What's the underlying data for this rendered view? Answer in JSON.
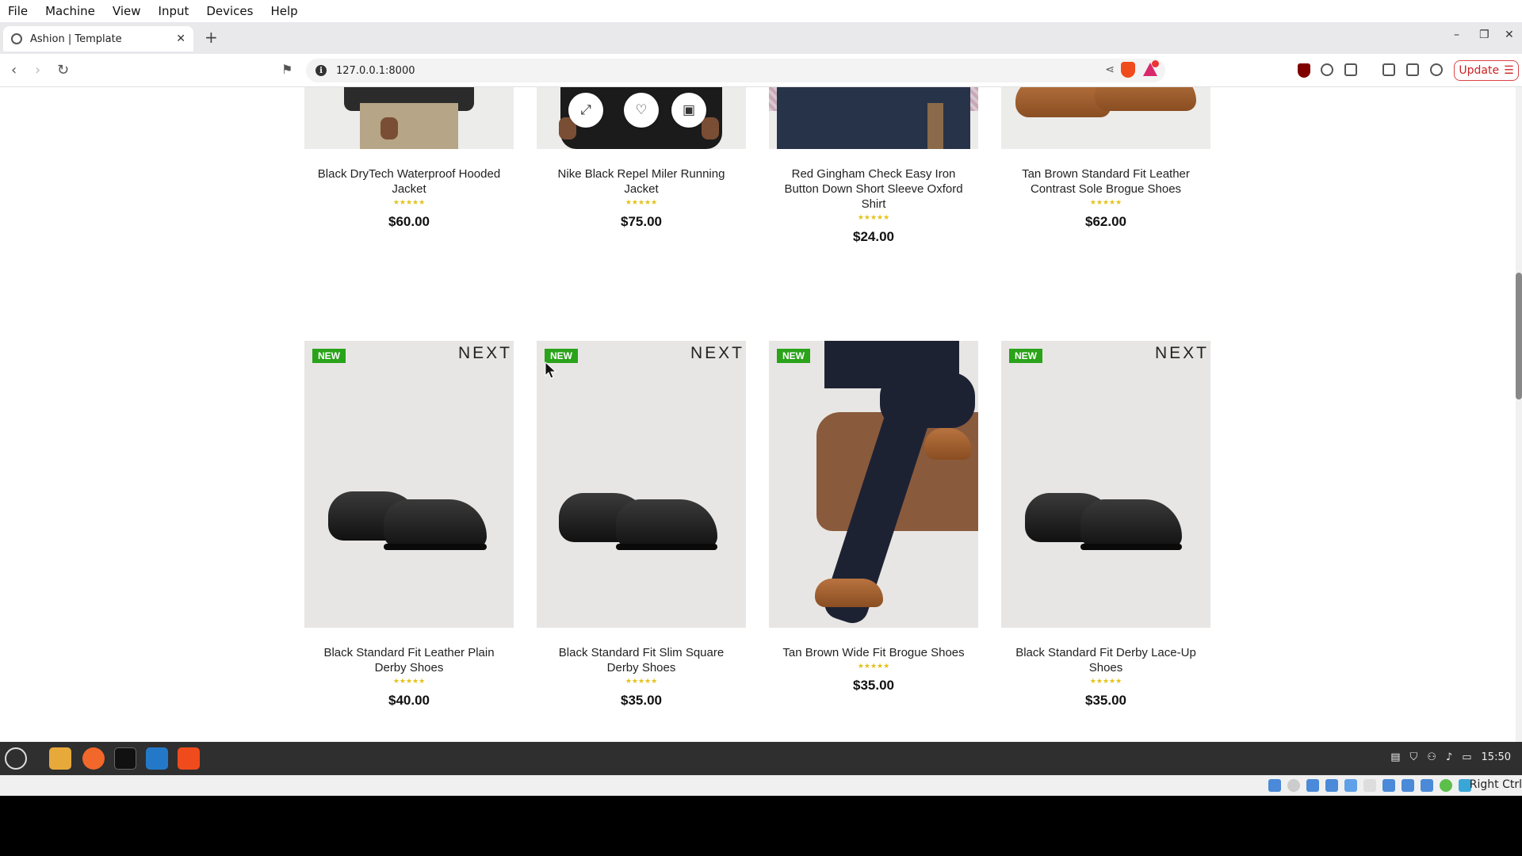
{
  "vbox_menu": [
    "File",
    "Machine",
    "View",
    "Input",
    "Devices",
    "Help"
  ],
  "browser": {
    "tab_title": "Ashion | Template",
    "url": "127.0.0.1:8000",
    "update_label": "Update"
  },
  "quick_view_icons": [
    "expand-icon",
    "heart-icon",
    "bag-icon"
  ],
  "products_row1": [
    {
      "title": "Black DryTech Waterproof Hooded Jacket",
      "rating": "★★★★★",
      "price": "$60.00"
    },
    {
      "title": "Nike Black Repel Miler Running Jacket",
      "rating": "★★★★★",
      "price": "$75.00"
    },
    {
      "title": "Red Gingham Check Easy Iron Button Down Short Sleeve Oxford Shirt",
      "rating": "★★★★★",
      "price": "$24.00"
    },
    {
      "title": "Tan Brown Standard Fit Leather Contrast Sole Brogue Shoes",
      "rating": "★★★★★",
      "price": "$62.00"
    }
  ],
  "products_row2": [
    {
      "badge": "NEW",
      "brand": "NEXT",
      "title": "Black Standard Fit Leather Plain Derby Shoes",
      "rating": "★★★★★",
      "price": "$40.00"
    },
    {
      "badge": "NEW",
      "brand": "NEXT",
      "title": "Black Standard Fit Slim Square Derby Shoes",
      "rating": "★★★★★",
      "price": "$35.00"
    },
    {
      "badge": "NEW",
      "brand": "",
      "title": "Tan Brown Wide Fit Brogue Shoes",
      "rating": "★★★★★",
      "price": "$35.00"
    },
    {
      "badge": "NEW",
      "brand": "NEXT",
      "title": "Black Standard Fit Derby Lace-Up Shoes",
      "rating": "★★★★★",
      "price": "$35.00"
    }
  ],
  "taskbar": {
    "clock": "15:50"
  },
  "vbox_status": {
    "host_key": "Right Ctrl"
  },
  "colors": {
    "badge_new": "#2aa31a",
    "rating": "#e3c21b",
    "brave_orange": "#f04b1d"
  }
}
